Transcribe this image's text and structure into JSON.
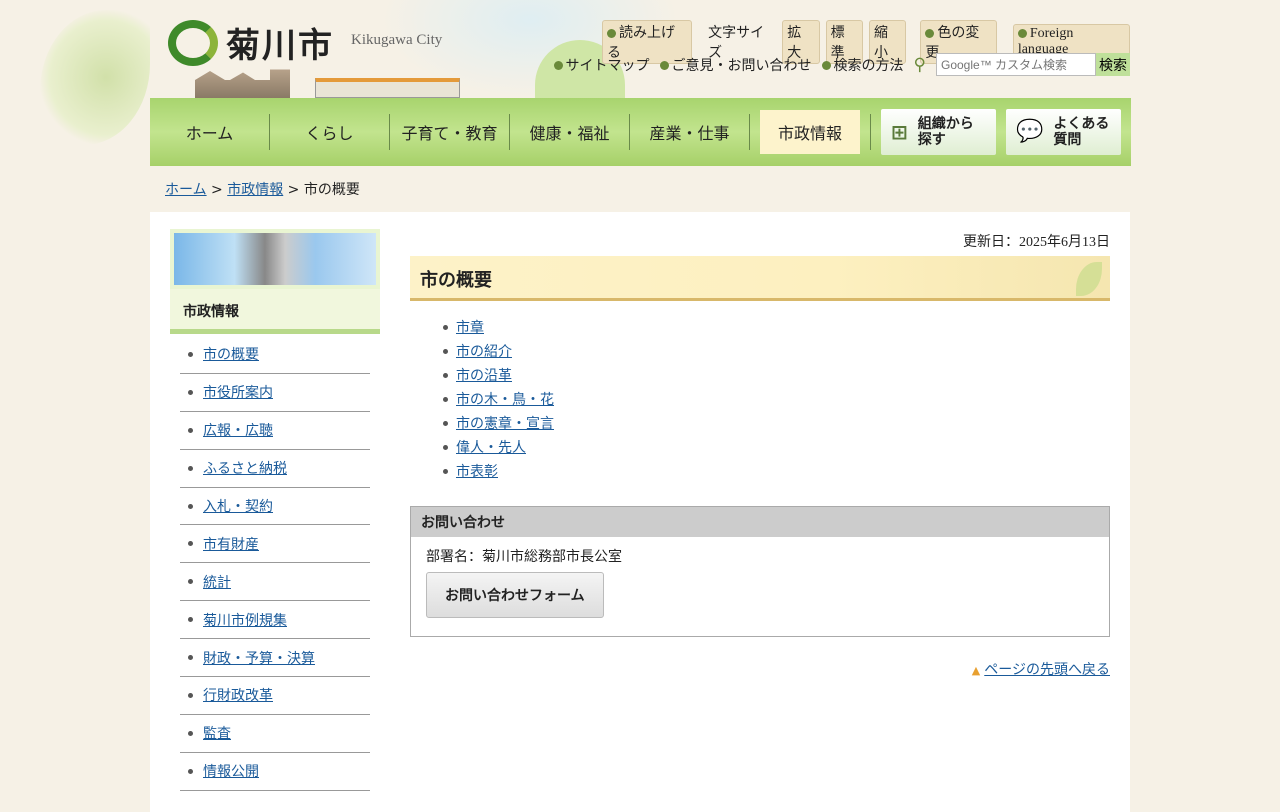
{
  "header": {
    "logo_text": "菊川市",
    "logo_en": "Kikugawa City"
  },
  "util": {
    "read_aloud": "読み上げる",
    "font_size_label": "文字サイズ",
    "font_large": "拡大",
    "font_normal": "標準",
    "font_small": "縮小",
    "color_change": "色の変更",
    "foreign": "Foreign language"
  },
  "links": {
    "sitemap": "サイトマップ",
    "opinion": "ご意見・お問い合わせ",
    "search_help": "検索の方法"
  },
  "search": {
    "placeholder": "Google™ カスタム検索",
    "button": "検索"
  },
  "nav": {
    "items": [
      "ホーム",
      "くらし",
      "子育て・教育",
      "健康・福祉",
      "産業・仕事",
      "市政情報"
    ],
    "org_l1": "組織から",
    "org_l2": "探す",
    "faq_l1": "よくある",
    "faq_l2": "質問"
  },
  "breadcrumb": {
    "home": "ホーム",
    "parent": "市政情報",
    "current": "市の概要"
  },
  "sidebar": {
    "title": "市政情報",
    "items": [
      "市の概要",
      "市役所案内",
      "広報・広聴",
      "ふるさと納税",
      "入札・契約",
      "市有財産",
      "統計",
      "菊川市例規集",
      "財政・予算・決算",
      "行財政改革",
      "監査",
      "情報公開"
    ]
  },
  "main": {
    "updated": "更新日：2025年6月13日",
    "title": "市の概要",
    "links": [
      "市章",
      "市の紹介",
      "市の沿革",
      "市の木・鳥・花",
      "市の憲章・宣言",
      "偉人・先人",
      "市表彰"
    ],
    "contact": {
      "heading": "お問い合わせ",
      "dept": "部署名：菊川市総務部市長公室",
      "form_button": "お問い合わせフォーム"
    },
    "to_top": "ページの先頭へ戻る"
  }
}
